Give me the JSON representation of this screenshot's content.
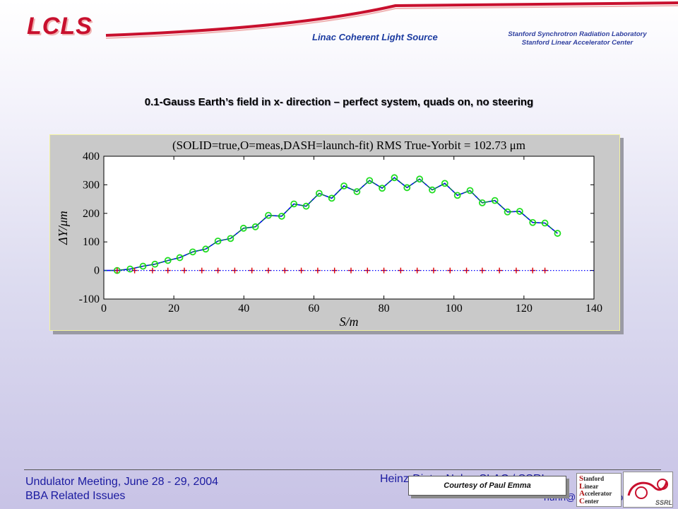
{
  "header": {
    "logo_text": "LCLS",
    "subtitle": "Linac Coherent Light Source",
    "lab_line1": "Stanford Synchrotron Radiation Laboratory",
    "lab_line2": "Stanford Linear Accelerator Center",
    "accent_color": "#c8102e",
    "text_color": "#1a3aa0"
  },
  "slide_title": "0.1-Gauss Earth’s field in x- direction – perfect system, quads on, no steering",
  "chart_data": {
    "type": "line",
    "title": "(SOLID=true,O=meas,DASH=launch-fit) RMS True-Yorbit = 102.73 μm",
    "xlabel": "S/m",
    "ylabel": "ΔY/μm",
    "xlim": [
      0,
      140
    ],
    "ylim": [
      -100,
      400
    ],
    "xticks": [
      0,
      20,
      40,
      60,
      80,
      100,
      120,
      140
    ],
    "yticks": [
      -100,
      0,
      100,
      200,
      300,
      400
    ],
    "grid": false,
    "series": [
      {
        "name": "true",
        "style": "solid",
        "color": "#0000ff",
        "x": [
          0,
          3.8,
          7.5,
          11.2,
          14.6,
          18.3,
          21.7,
          25.4,
          29.1,
          32.6,
          36.2,
          39.9,
          43.3,
          47.0,
          50.8,
          54.3,
          57.8,
          61.5,
          65.1,
          68.6,
          72.3,
          75.9,
          79.5,
          83.0,
          86.6,
          90.2,
          93.8,
          97.4,
          101.0,
          104.6,
          108.1,
          111.7,
          115.3,
          118.8,
          122.5,
          126.0,
          129.6
        ],
        "y": [
          0,
          0,
          5,
          15,
          22,
          35,
          45,
          65,
          75,
          103,
          112,
          148,
          153,
          193,
          190,
          233,
          225,
          270,
          253,
          296,
          276,
          315,
          288,
          325,
          290,
          320,
          282,
          305,
          263,
          280,
          237,
          245,
          205,
          207,
          168,
          166,
          130
        ]
      },
      {
        "name": "meas",
        "style": "markers",
        "marker": "circle",
        "color": "#22dd22",
        "x": [
          3.8,
          7.5,
          11.2,
          14.6,
          18.3,
          21.7,
          25.4,
          29.1,
          32.6,
          36.2,
          39.9,
          43.3,
          47.0,
          50.8,
          54.3,
          57.8,
          61.5,
          65.1,
          68.6,
          72.3,
          75.9,
          79.5,
          83.0,
          86.6,
          90.2,
          93.8,
          97.4,
          101.0,
          104.6,
          108.1,
          111.7,
          115.3,
          118.8,
          122.5,
          126.0,
          129.6
        ],
        "y": [
          0,
          5,
          15,
          22,
          35,
          45,
          65,
          75,
          103,
          112,
          148,
          153,
          193,
          190,
          233,
          225,
          270,
          253,
          296,
          276,
          315,
          288,
          325,
          290,
          320,
          282,
          305,
          263,
          280,
          237,
          245,
          205,
          207,
          168,
          166,
          130
        ]
      },
      {
        "name": "launch-fit",
        "style": "dash",
        "color": "#00aa00",
        "x": [
          0,
          3.8,
          7.5,
          11.2,
          14.6,
          18.3,
          21.7,
          25.4,
          29.1,
          32.6,
          36.2,
          39.9,
          43.3,
          47.0,
          50.8,
          54.3,
          57.8,
          61.5,
          65.1,
          68.6,
          72.3,
          75.9,
          79.5,
          83.0,
          86.6,
          90.2,
          93.8,
          97.4,
          101.0,
          104.6,
          108.1,
          111.7,
          115.3,
          118.8,
          122.5,
          126.0,
          129.6
        ],
        "y": [
          0,
          0,
          5,
          15,
          22,
          35,
          45,
          65,
          75,
          103,
          112,
          148,
          153,
          193,
          190,
          233,
          225,
          270,
          253,
          296,
          276,
          315,
          288,
          325,
          290,
          320,
          282,
          305,
          263,
          280,
          237,
          245,
          205,
          207,
          168,
          166,
          130
        ]
      },
      {
        "name": "quads",
        "style": "markers",
        "marker": "plus",
        "color": "#dd0000",
        "x": [
          3.8,
          8.8,
          13.9,
          18.3,
          23.0,
          28.0,
          32.6,
          37.4,
          42.3,
          47.0,
          51.7,
          56.4,
          61.1,
          65.9,
          70.6,
          75.3,
          80.0,
          84.8,
          89.5,
          94.2,
          98.9,
          103.6,
          108.1,
          113.0,
          117.8,
          122.5,
          126.0
        ],
        "y": [
          0,
          0,
          0,
          0,
          0,
          0,
          0,
          0,
          0,
          0,
          0,
          0,
          0,
          0,
          0,
          0,
          0,
          0,
          0,
          0,
          0,
          0,
          0,
          0,
          0,
          0,
          0
        ]
      },
      {
        "name": "zero",
        "style": "dotted",
        "color": "#0000ff",
        "x": [
          0,
          140
        ],
        "y": [
          0,
          0
        ]
      }
    ]
  },
  "footer": {
    "meeting": "Undulator Meeting, June 28 - 29, 2004",
    "topic": "BBA Related Issues",
    "author": "Heinz-Dieter Nuhn, SLAC / SSRL",
    "email": "nuhn@slac.stanford.edu",
    "courtesy": "Courtesy of Paul Emma",
    "slac_lines": [
      "Stanford",
      "Linear",
      "Accelerator",
      "Center"
    ],
    "ssrl_label": "SSRL"
  }
}
